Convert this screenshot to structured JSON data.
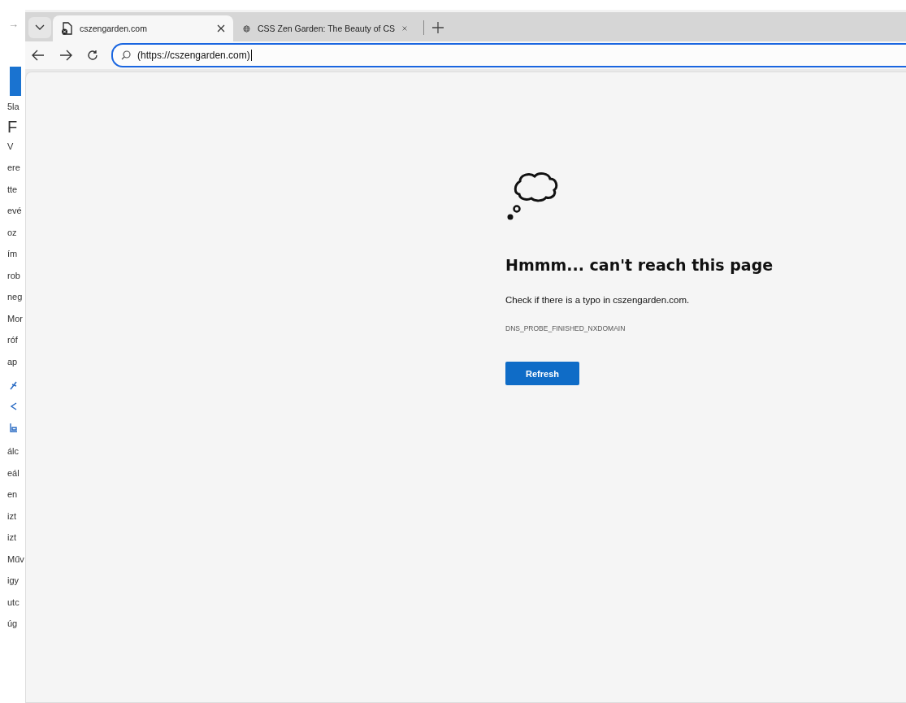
{
  "background_window": {
    "arrow": "→",
    "items": [
      "5la",
      "F",
      "V",
      "ere",
      "tte",
      "evé",
      "oz",
      "ím",
      "rob",
      "neg",
      "Mor",
      "róf",
      "ap",
      "álc",
      "eál",
      "en",
      "izt",
      "izt",
      "Műv",
      "igy",
      "utc",
      "úg"
    ]
  },
  "tabs": [
    {
      "title": "cszengarden.com",
      "kind": "error",
      "selected": true
    },
    {
      "title": "CSS Zen Garden: The Beauty of CS",
      "kind": "web",
      "selected": false
    }
  ],
  "address_bar": {
    "value": "(https://cszengarden.com)"
  },
  "error_page": {
    "heading": "Hmmm... can't reach this page",
    "message": "Check if there is a typo in cszengarden.com.",
    "code": "DNS_PROBE_FINISHED_NXDOMAIN",
    "button": "Refresh"
  }
}
